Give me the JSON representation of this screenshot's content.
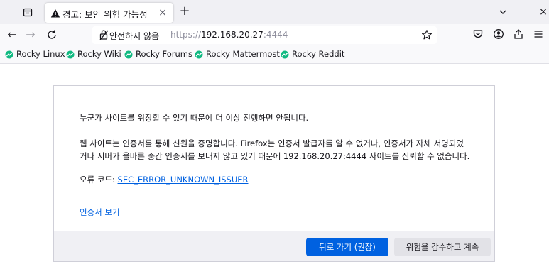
{
  "tab": {
    "title": "경고: 보안 위험 가능성",
    "close": "×",
    "new_tab": "+"
  },
  "window": {
    "close": "×"
  },
  "nav": {
    "back": "←",
    "forward": "→"
  },
  "urlbar": {
    "security_label": "안전하지 않음",
    "scheme": "https://",
    "host": "192.168.20.27",
    "port": ":4444"
  },
  "bookmarks": [
    {
      "label": "Rocky Linux"
    },
    {
      "label": "Rocky Wiki"
    },
    {
      "label": "Rocky Forums"
    },
    {
      "label": "Rocky Mattermost"
    },
    {
      "label": "Rocky Reddit"
    }
  ],
  "warning": {
    "intro": "누군가 사이트를 위장할 수 있기 때문에 더 이상 진행하면 안됩니다.",
    "detail_line1": "웹 사이트는 인증서를 통해 신원을 증명합니다. Firefox는 인증서 발급자를 알 수 없거나, 인증서가 자체 서명되었",
    "detail_line2": "거나 서버가 올바른 중간 인증서를 보내지 않고 있기 때문에 192.168.20.27:4444 사이트를 신뢰할 수 없습니다.",
    "error_code_label": "오류 코드: ",
    "error_code": "SEC_ERROR_UNKNOWN_ISSUER",
    "view_certificate": "인증서 보기",
    "go_back_button": "뒤로 가기 (권장)",
    "accept_risk_button": "위험을 감수하고 계속"
  },
  "colors": {
    "accent": "#0061e0",
    "bookmark_icon": "#10b981",
    "warning_icon": "#15141a"
  },
  "icons": {
    "tab_list": "tab-list-icon",
    "warning": "warning-icon",
    "reload": "reload-icon",
    "not_secure": "not-secure-lock-icon",
    "bookmark_star": "star-icon",
    "pocket": "pocket-icon",
    "account": "account-icon",
    "share": "share-icon",
    "menu": "hamburger-menu-icon",
    "rocky": "rocky-logo-icon"
  }
}
